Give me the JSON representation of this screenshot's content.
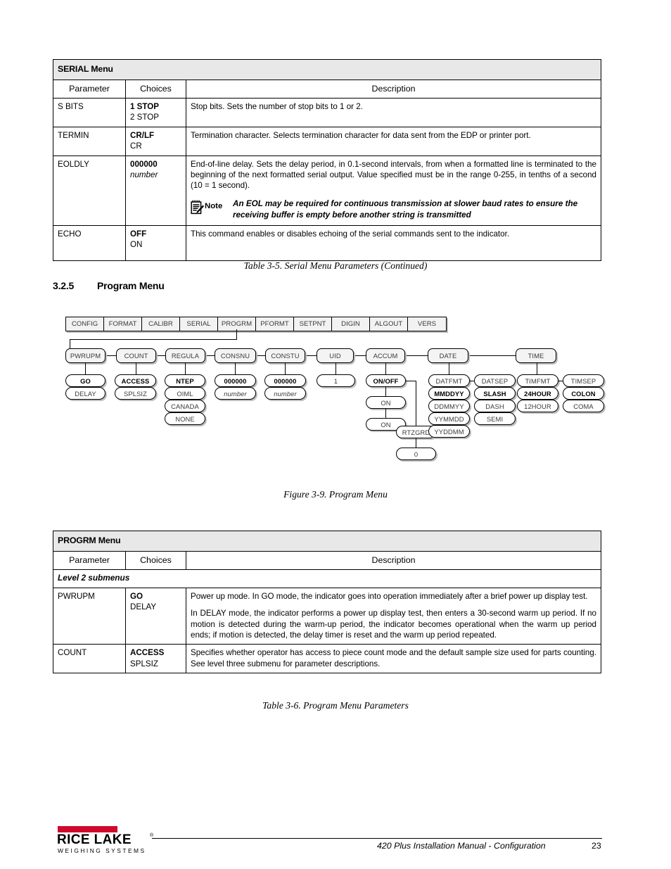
{
  "serial_table": {
    "title": "SERIAL Menu",
    "headers": [
      "Parameter",
      "Choices",
      "Description"
    ],
    "rows": [
      {
        "parameter": "S BITS",
        "choices": [
          "1 STOP",
          "2 STOP"
        ],
        "description": [
          "Stop bits. Sets the number of stop bits to 1 or 2."
        ]
      },
      {
        "parameter": "TERMIN",
        "choices": [
          "CR/LF",
          "CR"
        ],
        "description": [
          "Termination character. Selects termination character for data sent from the EDP or printer port."
        ]
      },
      {
        "parameter": "EOLDLY",
        "choices": [
          "000000",
          "number"
        ],
        "description": [
          "End-of-line delay. Sets the delay period, in 0.1-second intervals, from when a formatted line is terminated to the beginning of the next formatted serial output. Value specified must be in the range 0-255, in tenths of a second (10 = 1 second)."
        ],
        "note": {
          "label": "Note",
          "icon": "notepad-pencil-icon",
          "text": "An EOL may be required for continuous transmission at slower baud rates to ensure the receiving buffer is empty before another string is transmitted"
        }
      },
      {
        "parameter": "ECHO",
        "choices": [
          "OFF",
          "ON"
        ],
        "description": [
          "This command enables or disables echoing of the serial commands sent to the indicator."
        ]
      }
    ],
    "caption": "Table 3-5. Serial Menu Parameters (Continued)"
  },
  "section": {
    "number": "3.2.5",
    "title": "Program Menu"
  },
  "figure": {
    "caption": "Figure 3-9. Program Menu",
    "menubar": [
      "CONFIG",
      "FORMAT",
      "CALIBR",
      "SERIAL",
      "PROGRM",
      "PFORMT",
      "SETPNT",
      "DIGIN",
      "ALGOUT",
      "VERS"
    ],
    "selected_menu": "PROGRM",
    "level2": [
      "PWRUPM",
      "COUNT",
      "REGULA",
      "CONSNU",
      "CONSTU",
      "UID",
      "ACCUM",
      "DATE",
      "TIME"
    ],
    "branches": {
      "PWRUPM": [
        "GO",
        "DELAY"
      ],
      "COUNT": [
        "ACCESS",
        "SPLSIZ"
      ],
      "REGULA": [
        "NTEP",
        "OIML",
        "CANADA",
        "NONE"
      ],
      "CONSNU": [
        "000000",
        "number"
      ],
      "CONSTU": [
        "000000",
        "number"
      ],
      "UID": [
        "1"
      ],
      "ACCUM": [
        "ON/OFF",
        "ON",
        "ON"
      ],
      "RTZGRD": [
        "RTZGRD",
        "0"
      ],
      "DATFMT": [
        "DATFMT",
        "MMDDYY",
        "DDMMYY",
        "YYMMDD",
        "YYDDMM"
      ],
      "DATSEP": [
        "DATSEP",
        "SLASH",
        "DASH",
        "SEMI"
      ],
      "TIMFMT": [
        "TIMFMT",
        "24HOUR",
        "12HOUR"
      ],
      "TIMSEP": [
        "TIMSEP",
        "COLON",
        "COMA"
      ]
    },
    "defaults": [
      "GO",
      "ACCESS",
      "NTEP",
      "000000",
      "000000",
      "ON/OFF",
      "MMDDYY",
      "SLASH",
      "24HOUR",
      "COLON"
    ]
  },
  "progrm_table": {
    "title": "PROGRM Menu",
    "headers": [
      "Parameter",
      "Choices",
      "Description"
    ],
    "subheader": "Level 2 submenus",
    "rows": [
      {
        "parameter": "PWRUPM",
        "choices": [
          "GO",
          "DELAY"
        ],
        "description": [
          "Power up mode. In GO mode, the indicator goes into operation immediately after a brief power up display test.",
          "In DELAY mode, the indicator performs a power up display test, then enters a 30-second warm up period. If no motion is detected during the warm-up period, the indicator becomes operational when the warm up period ends; if motion is detected, the delay timer is reset and the warm up period repeated."
        ]
      },
      {
        "parameter": "COUNT",
        "choices": [
          "ACCESS",
          "SPLSIZ"
        ],
        "description": [
          "Specifies whether operator has access to piece count mode and the default sample size used for parts counting. See level three submenu for parameter descriptions."
        ]
      }
    ],
    "caption": "Table 3-6. Program Menu Parameters"
  },
  "footer": {
    "logo_name": "RICE LAKE",
    "logo_sub": "WEIGHING SYSTEMS",
    "logo_tm": "®",
    "manual": "420 Plus Installation Manual - Configuration",
    "page": "23",
    "accent_color": "#cf0a2c"
  }
}
